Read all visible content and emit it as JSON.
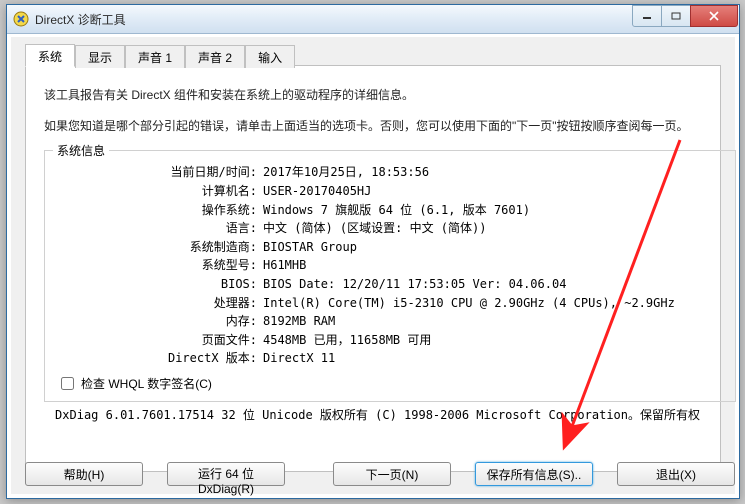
{
  "window": {
    "title": "DirectX 诊断工具"
  },
  "tabs": {
    "system": "系统",
    "display": "显示",
    "sound1": "声音 1",
    "sound2": "声音 2",
    "input": "输入"
  },
  "intro": {
    "line1": "该工具报告有关 DirectX 组件和安装在系统上的驱动程序的详细信息。",
    "line2": "如果您知道是哪个部分引起的错误，请单击上面适当的选项卡。否则，您可以使用下面的\"下一页\"按钮按顺序查阅每一页。"
  },
  "group_title": "系统信息",
  "rows": [
    {
      "label": "当前日期/时间:",
      "value": "2017年10月25日, 18:53:56"
    },
    {
      "label": "计算机名:",
      "value": "USER-20170405HJ"
    },
    {
      "label": "操作系统:",
      "value": "Windows 7 旗舰版 64 位 (6.1, 版本 7601)"
    },
    {
      "label": "语言:",
      "value": "中文 (简体) (区域设置: 中文 (简体))"
    },
    {
      "label": "系统制造商:",
      "value": "BIOSTAR Group"
    },
    {
      "label": "系统型号:",
      "value": "H61MHB"
    },
    {
      "label": "BIOS:",
      "value": "BIOS Date: 12/20/11 17:53:05 Ver: 04.06.04"
    },
    {
      "label": "处理器:",
      "value": "Intel(R) Core(TM) i5-2310 CPU @ 2.90GHz (4 CPUs), ~2.9GHz"
    },
    {
      "label": "内存:",
      "value": "8192MB RAM"
    },
    {
      "label": "页面文件:",
      "value": "4548MB 已用，11658MB 可用"
    },
    {
      "label": "DirectX 版本:",
      "value": "DirectX 11"
    }
  ],
  "whql_label": "检查 WHQL 数字签名(C)",
  "copyright": "DxDiag 6.01.7601.17514 32 位 Unicode 版权所有 (C) 1998-2006 Microsoft Corporation。保留所有权",
  "buttons": {
    "help": "帮助(H)",
    "run64": "运行 64 位 DxDiag(R)",
    "next": "下一页(N)",
    "saveall": "保存所有信息(S)..",
    "exit": "退出(X)"
  }
}
